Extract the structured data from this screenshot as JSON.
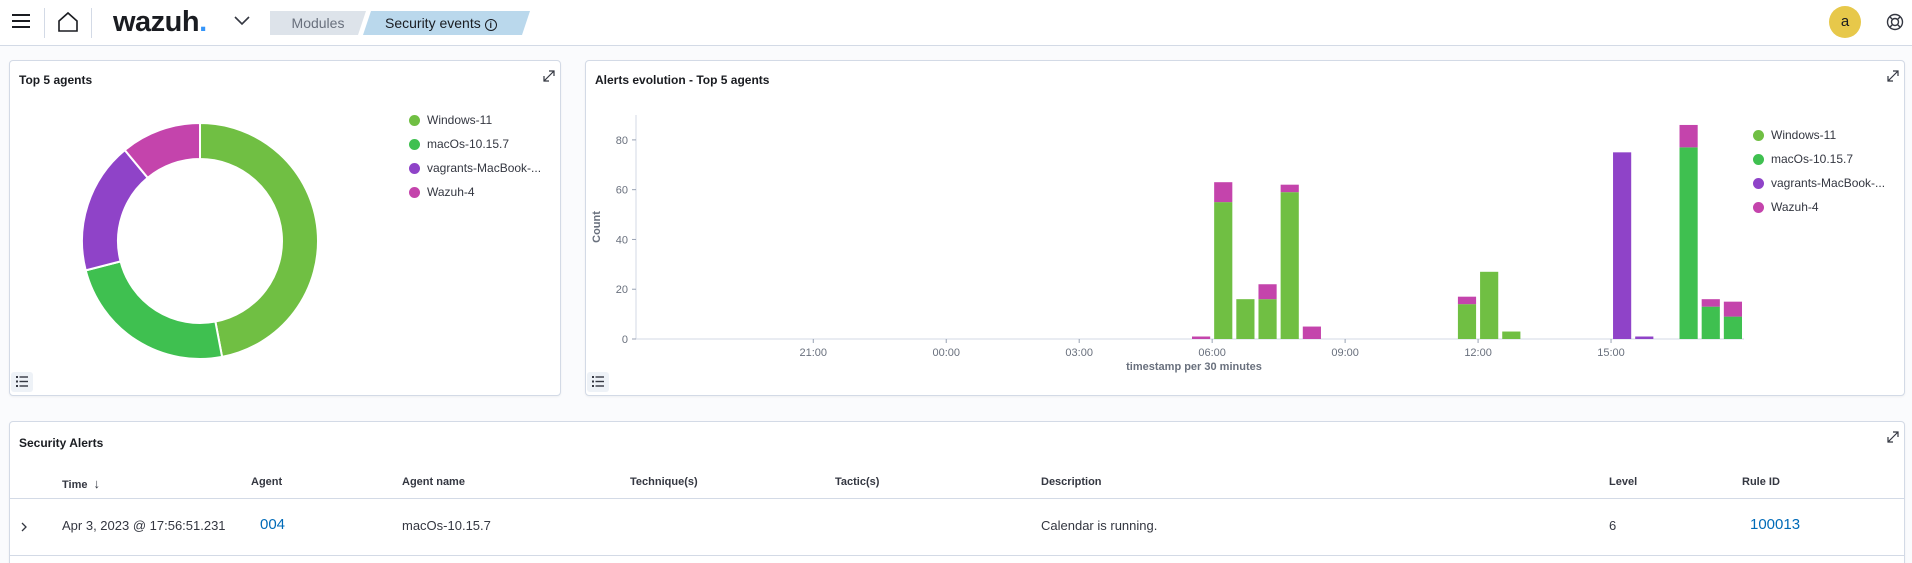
{
  "header": {
    "logo": "wazuh",
    "logo_dot": ".",
    "breadcrumbs": [
      "Modules",
      "Security events"
    ],
    "info_glyph": "i",
    "avatar_initial": "a"
  },
  "colors": {
    "windows": "#70bf43",
    "macos": "#3fc050",
    "vagrant": "#8f43c8",
    "wazuh": "#c444ac",
    "link": "#006bb8"
  },
  "panels": {
    "top_agents_title": "Top 5 agents",
    "alerts_evolution_title": "Alerts evolution - Top 5 agents",
    "security_alerts_title": "Security Alerts"
  },
  "legend": [
    "Windows-11",
    "macOs-10.15.7",
    "vagrants-MacBook-...",
    "Wazuh-4"
  ],
  "chart_data": [
    {
      "type": "pie",
      "title": "Top 5 agents",
      "donut": true,
      "labels": [
        "Windows-11",
        "macOs-10.15.7",
        "vagrants-MacBook-...",
        "Wazuh-4"
      ],
      "values": [
        47,
        24,
        18,
        11
      ],
      "colors": [
        "#70bf43",
        "#3fc050",
        "#8f43c8",
        "#c444ac"
      ],
      "legend_position": "right"
    },
    {
      "type": "bar",
      "stacked": true,
      "title": "Alerts evolution - Top 5 agents",
      "xlabel": "timestamp per 30 minutes",
      "ylabel": "Count",
      "ylim": [
        0,
        90
      ],
      "yticks": [
        0,
        20,
        40,
        60,
        80
      ],
      "x_domain": [
        "2023-04-02T17:00",
        "2023-04-03T18:00"
      ],
      "xtick_times": [
        "2023-04-02T21:00",
        "2023-04-03T00:00",
        "2023-04-03T03:00",
        "2023-04-03T06:00",
        "2023-04-03T09:00",
        "2023-04-03T12:00",
        "2023-04-03T15:00"
      ],
      "xtick_labels": [
        "21:00",
        "00:00",
        "03:00",
        "06:00",
        "09:00",
        "12:00",
        "15:00"
      ],
      "x": [
        "2023-04-03T05:30",
        "2023-04-03T06:00",
        "2023-04-03T06:30",
        "2023-04-03T07:00",
        "2023-04-03T07:30",
        "2023-04-03T08:00",
        "2023-04-03T11:30",
        "2023-04-03T12:00",
        "2023-04-03T12:30",
        "2023-04-03T15:00",
        "2023-04-03T15:30",
        "2023-04-03T16:30",
        "2023-04-03T17:00",
        "2023-04-03T17:30"
      ],
      "series": [
        {
          "name": "Windows-11",
          "color": "#70bf43",
          "values": [
            0,
            55,
            16,
            16,
            59,
            0,
            14,
            27,
            3,
            0,
            0,
            0,
            0,
            0
          ]
        },
        {
          "name": "macOs-10.15.7",
          "color": "#3fc050",
          "values": [
            0,
            0,
            0,
            0,
            0,
            0,
            0,
            0,
            0,
            0,
            0,
            77,
            13,
            9
          ]
        },
        {
          "name": "vagrants-MacBook-...",
          "color": "#8f43c8",
          "values": [
            0,
            0,
            0,
            0,
            0,
            0,
            0,
            0,
            0,
            75,
            1,
            0,
            0,
            0
          ]
        },
        {
          "name": "Wazuh-4",
          "color": "#c444ac",
          "values": [
            1,
            8,
            0,
            6,
            3,
            5,
            3,
            0,
            0,
            0,
            0,
            9,
            3,
            6
          ]
        }
      ],
      "legend_position": "right",
      "grid": false
    }
  ],
  "table": {
    "columns": [
      "Time",
      "Agent",
      "Agent name",
      "Technique(s)",
      "Tactic(s)",
      "Description",
      "Level",
      "Rule ID"
    ],
    "sort_arrow": "↓",
    "rows": [
      {
        "time": "Apr 3, 2023 @ 17:56:51.231",
        "agent": "004",
        "agent_name": "macOs-10.15.7",
        "techniques": "",
        "tactics": "",
        "description": "Calendar is running.",
        "level": "6",
        "rule_id": "100013"
      }
    ]
  }
}
